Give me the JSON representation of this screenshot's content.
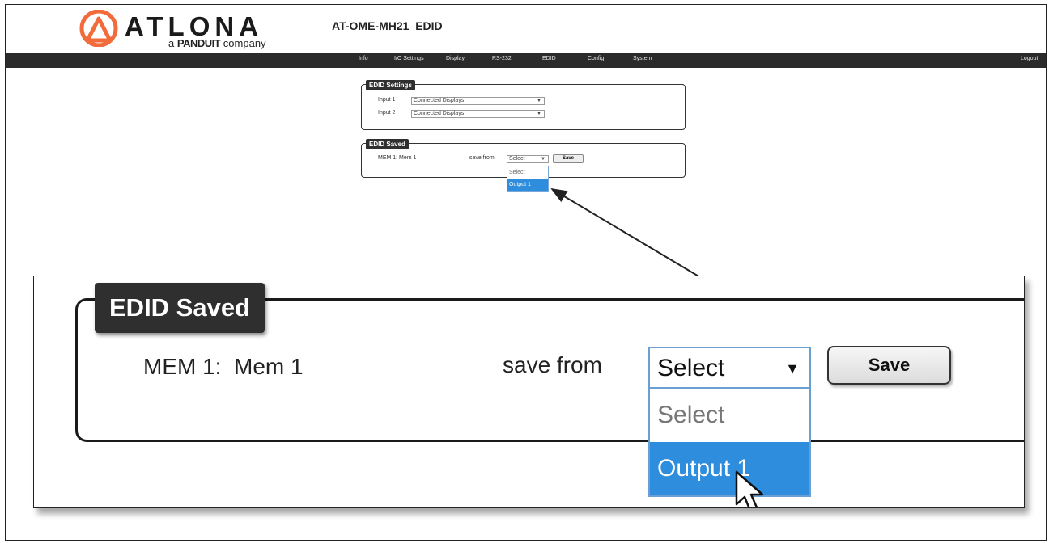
{
  "header": {
    "logo_text": "ATLONA",
    "logo_subtitle_prefix": "a",
    "logo_subtitle_brand": "PANDUIT",
    "logo_subtitle_suffix": "company",
    "device_title": "AT-OME-MH21  EDID",
    "logo_color": "#f26b3a"
  },
  "nav": {
    "items": [
      "Info",
      "I/O Settings",
      "Display",
      "RS-232",
      "EDID",
      "Config",
      "System"
    ],
    "logout": "Logout"
  },
  "edid_settings": {
    "legend": "EDID Settings",
    "rows": [
      {
        "label": "Input 1",
        "value": "Connected Displays"
      },
      {
        "label": "Input 2",
        "value": "Connected Displays"
      }
    ]
  },
  "edid_saved": {
    "legend": "EDID Saved",
    "mem_label": "MEM 1:  Mem 1",
    "save_from_label": "save from",
    "select_value": "Select",
    "save_button": "Save",
    "options": [
      "Select",
      "Output 1"
    ],
    "highlighted_option": "Output 1",
    "highlight_color": "#2e8ddc"
  }
}
